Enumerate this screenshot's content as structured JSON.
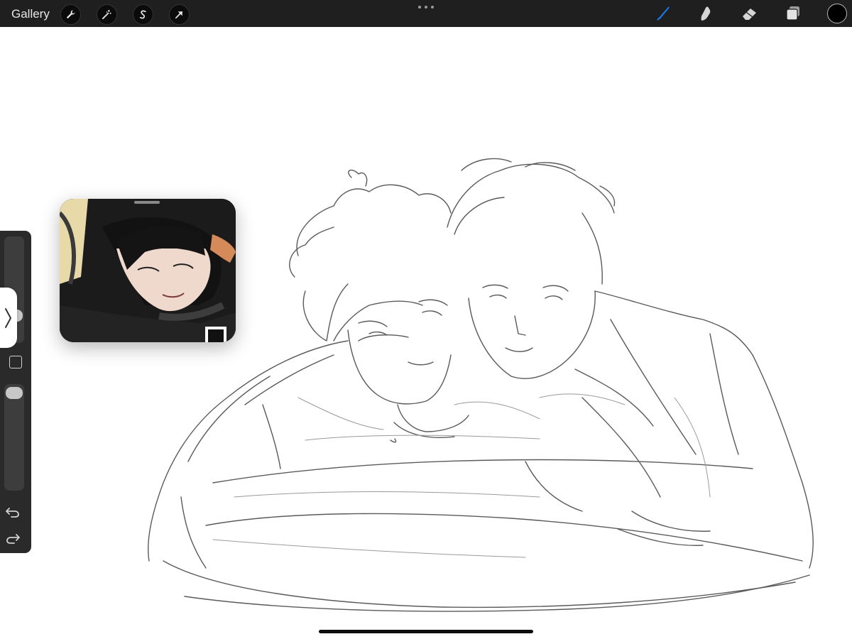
{
  "toolbar": {
    "gallery_label": "Gallery",
    "left_tools": [
      "wrench-icon",
      "magic-wand-icon",
      "selection-s-icon",
      "transform-arrow-icon"
    ],
    "right_tools": [
      "brush-icon",
      "smudge-icon",
      "eraser-icon",
      "layers-icon"
    ],
    "active_tool": "brush-icon",
    "accent_color": "#1a7cf2",
    "current_color": "#000000"
  },
  "sidebar": {
    "brush_size_level": 0.3,
    "opacity_level": 0.95,
    "buttons": [
      "modify-button",
      "undo-icon",
      "redo-icon"
    ]
  },
  "reference": {
    "title": "",
    "content": "manga-illustration-dark-haired-character"
  },
  "canvas": {
    "content": "pencil-sketch-two-characters"
  }
}
